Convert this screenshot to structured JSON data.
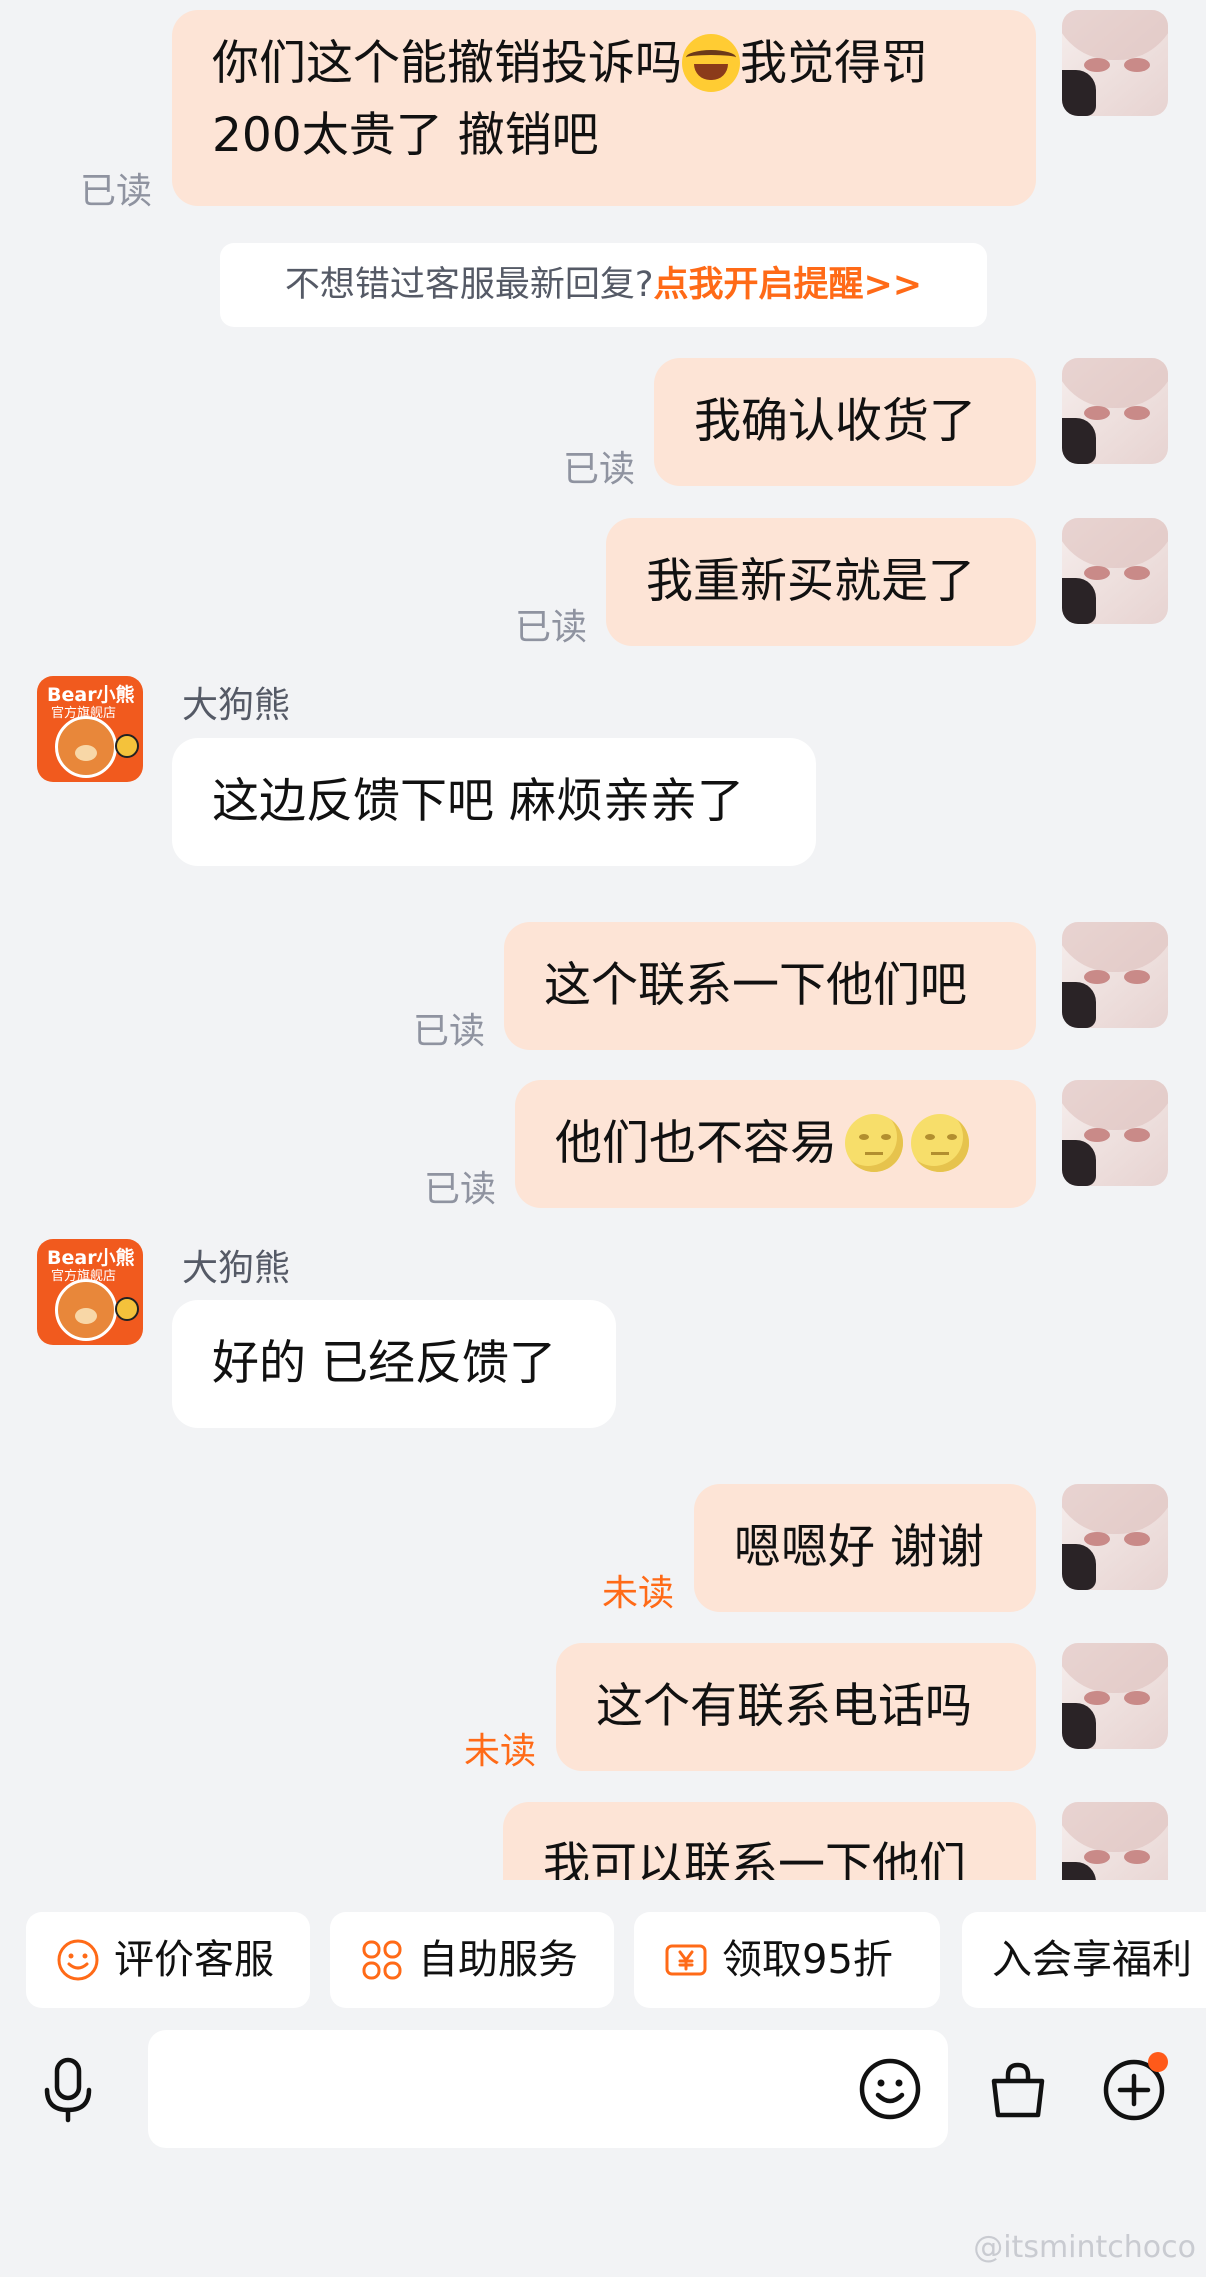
{
  "messages": {
    "m1_part1": "你们这个能撤销投诉吗",
    "m1_part2": "我觉得罚",
    "m1_line2": "200太贵了 撤销吧",
    "m2": "我确认收货了",
    "m3": "我重新买就是了",
    "m4": "这边反馈下吧 麻烦亲亲了",
    "m5": "这个联系一下他们吧",
    "m6": "他们也不容易",
    "m7": "好的 已经反馈了",
    "m8": "嗯嗯好 谢谢",
    "m9": "这个有联系电话吗",
    "m10": "我可以联系一下他们"
  },
  "status": {
    "read": "已读",
    "unread": "未读"
  },
  "shop": {
    "name": "大狗熊",
    "logo": "Bear小熊",
    "logo_sub": "官方旗舰店"
  },
  "notice": {
    "text": "不想错过客服最新回复?",
    "link": "点我开启提醒>>"
  },
  "quick_actions": {
    "rate": "评价客服",
    "self_service": "自助服务",
    "coupon": "领取95折",
    "membership": "入会享福利"
  },
  "watermark": "@itsmintchoco",
  "colors": {
    "outgoing_bubble": "#fde4d6",
    "incoming_bubble": "#ffffff",
    "accent": "#ff6a17",
    "background": "#f2f3f5"
  },
  "icons": {
    "emoji_1": "face-with-tears-of-joy",
    "emoji_2": "new-moon-face",
    "mic": "microphone-icon",
    "emoji_btn": "smiley-icon",
    "bag": "shopping-bag-icon",
    "plus": "plus-circle-icon"
  }
}
